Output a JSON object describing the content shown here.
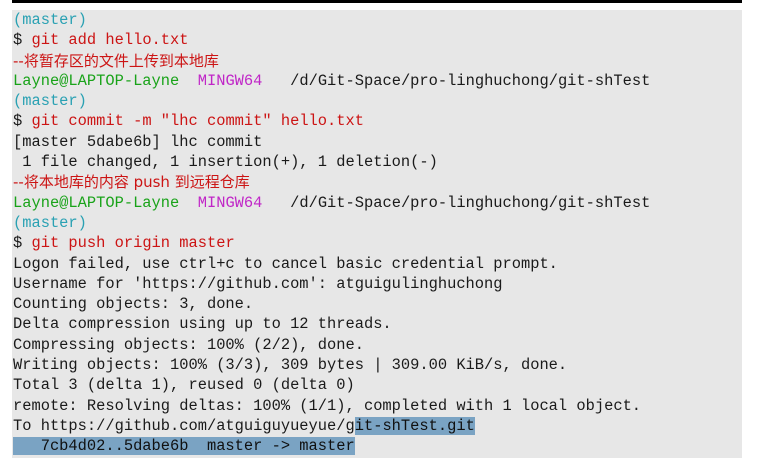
{
  "lines": [
    {
      "type": "branch",
      "text": "(master)"
    },
    {
      "type": "cmd",
      "prompt": "$ ",
      "text": "git add hello.txt"
    },
    {
      "type": "comment",
      "text": "--将暂存区的文件上传到本地库"
    },
    {
      "type": "user",
      "user": "Layne@LAPTOP-Layne",
      "env": "MINGW64",
      "path": "/d/Git-Space/pro-linghuchong/git-shTest"
    },
    {
      "type": "branch",
      "text": "(master)"
    },
    {
      "type": "cmd",
      "prompt": "$ ",
      "text": "git commit -m \"lhc commit\" hello.txt"
    },
    {
      "type": "plain",
      "text": "[master 5dabe6b] lhc commit"
    },
    {
      "type": "plain",
      "text": " 1 file changed, 1 insertion(+), 1 deletion(-)"
    },
    {
      "type": "comment",
      "text": "--将本地库的内容 push 到远程仓库"
    },
    {
      "type": "user",
      "user": "Layne@LAPTOP-Layne",
      "env": "MINGW64",
      "path": "/d/Git-Space/pro-linghuchong/git-shTest"
    },
    {
      "type": "branch",
      "text": "(master)"
    },
    {
      "type": "cmd",
      "prompt": "$ ",
      "text": "git push origin master"
    },
    {
      "type": "plain",
      "text": "Logon failed, use ctrl+c to cancel basic credential prompt."
    },
    {
      "type": "plain",
      "text": "Username for 'https://github.com': atguigulinghuchong"
    },
    {
      "type": "plain",
      "text": "Counting objects: 3, done."
    },
    {
      "type": "plain",
      "text": "Delta compression using up to 12 threads."
    },
    {
      "type": "plain",
      "text": "Compressing objects: 100% (2/2), done."
    },
    {
      "type": "plain",
      "text": "Writing objects: 100% (3/3), 309 bytes | 309.00 KiB/s, done."
    },
    {
      "type": "plain",
      "text": "Total 3 (delta 1), reused 0 (delta 0)"
    },
    {
      "type": "plain",
      "text": "remote: Resolving deltas: 100% (1/1), completed with 1 local object."
    },
    {
      "type": "split",
      "text": "To https://github.com/atguiguyueyue/g",
      "hl": "it-shTest.git"
    },
    {
      "type": "hlline",
      "text": "   7cb4d02..5dabe6b  master -> master"
    }
  ],
  "colors": {
    "background": "#e7e7e7",
    "branch": "#2aa1b3",
    "command": "#cc1414",
    "user": "#19a319",
    "env": "#c026c7",
    "selection": "#7aa3c3"
  }
}
